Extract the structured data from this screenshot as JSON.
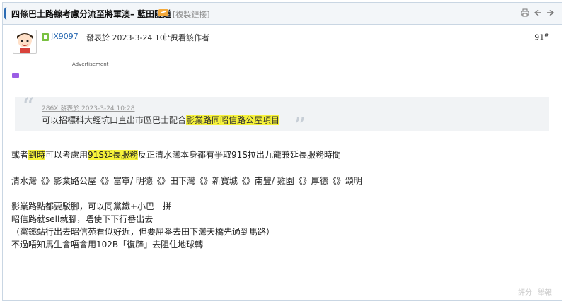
{
  "thread": {
    "title": "四條巴士路線考慮分流至將軍澳– 藍田隧道",
    "copy_link": "[複製鏈接]"
  },
  "post": {
    "username": "JX9097",
    "posted_on": "發表於 2023-3-24 10:56",
    "separator": "|",
    "author_only": "只看該作者",
    "floor": "91",
    "floor_mark": "#"
  },
  "ad": {
    "label": "Advertisement"
  },
  "quote": {
    "meta": "286X 發表於 2023-3-24 10:28",
    "text_before": "可以招標科大經坑口直出市區巴士配合",
    "text_highlight": "影業路同昭信路公屋項目"
  },
  "body": {
    "line1_a": "或者",
    "line1_b": "到時",
    "line1_c": "可以考慮用",
    "line1_d": "91S延長服務",
    "line1_e": "反正清水灣本身都有爭取91S拉出九龍兼延長服務時間",
    "line2": "清水灣《》影業路公屋《》富寧/ 明德《》田下灣《》新寶城《》南豐/ 雞園《》厚德《》頌明",
    "line3": "影業路點都要駁腳，可以同黨鐵+小巴一拼",
    "line4": "昭信路就sell就腳，唔使下下行番出去",
    "line5": "（黨鐵站行出去昭信苑看似好近，但要屈番去田下灣天橋先過到馬路）",
    "line6": "不過唔知馬生會唔會用102B「復辟」去阻住地球轉"
  },
  "footer": {
    "rate": "評分",
    "report": "舉報"
  },
  "icons": {
    "print": "print-icon",
    "prev": "prev-thread-icon",
    "next": "next-thread-icon"
  }
}
